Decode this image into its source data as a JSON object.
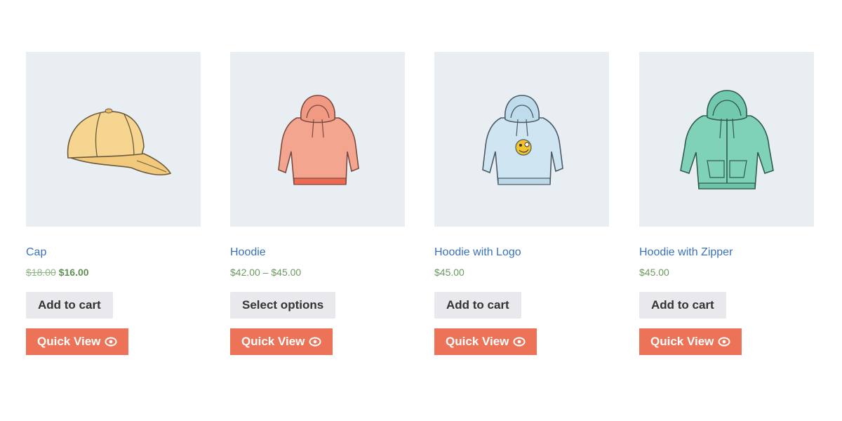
{
  "products": [
    {
      "name": "Cap",
      "price_old": "$18.00",
      "price_new": "$16.00",
      "price": "",
      "cart_label": "Add to cart",
      "quick_label": "Quick View",
      "image_icon": "cap-icon"
    },
    {
      "name": "Hoodie",
      "price_old": "",
      "price_new": "",
      "price": "$42.00 – $45.00",
      "cart_label": "Select options",
      "quick_label": "Quick View",
      "image_icon": "hoodie-icon"
    },
    {
      "name": "Hoodie with Logo",
      "price_old": "",
      "price_new": "",
      "price": "$45.00",
      "cart_label": "Add to cart",
      "quick_label": "Quick View",
      "image_icon": "hoodie-with-logo-icon"
    },
    {
      "name": "Hoodie with Zipper",
      "price_old": "",
      "price_new": "",
      "price": "$45.00",
      "cart_label": "Add to cart",
      "quick_label": "Quick View",
      "image_icon": "hoodie-with-zipper-icon"
    }
  ],
  "colors": {
    "thumb_bg": "#e9eef3",
    "link": "#3a72b8",
    "price": "#6a9a5f",
    "cart_button_bg": "#e9e8ec",
    "quick_view_bg": "#ec7358",
    "cap": "#f6d591",
    "hoodie": "#f4a590",
    "hoodie_logo": "#cfe6f2",
    "hoodie_zipper": "#7fd2b7"
  }
}
